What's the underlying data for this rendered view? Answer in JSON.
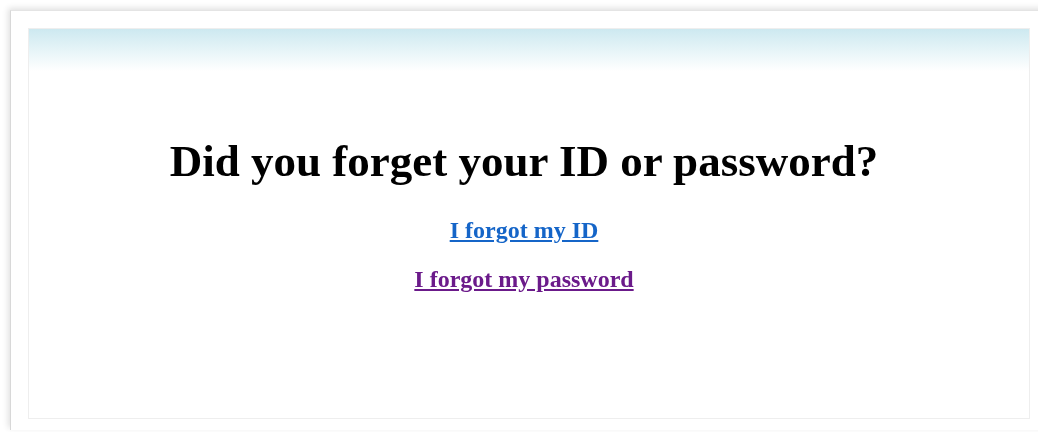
{
  "heading": "Did you forget your ID or password?",
  "links": [
    {
      "label": "I forgot my ID",
      "visited": false
    },
    {
      "label": "I forgot my password",
      "visited": true
    }
  ]
}
